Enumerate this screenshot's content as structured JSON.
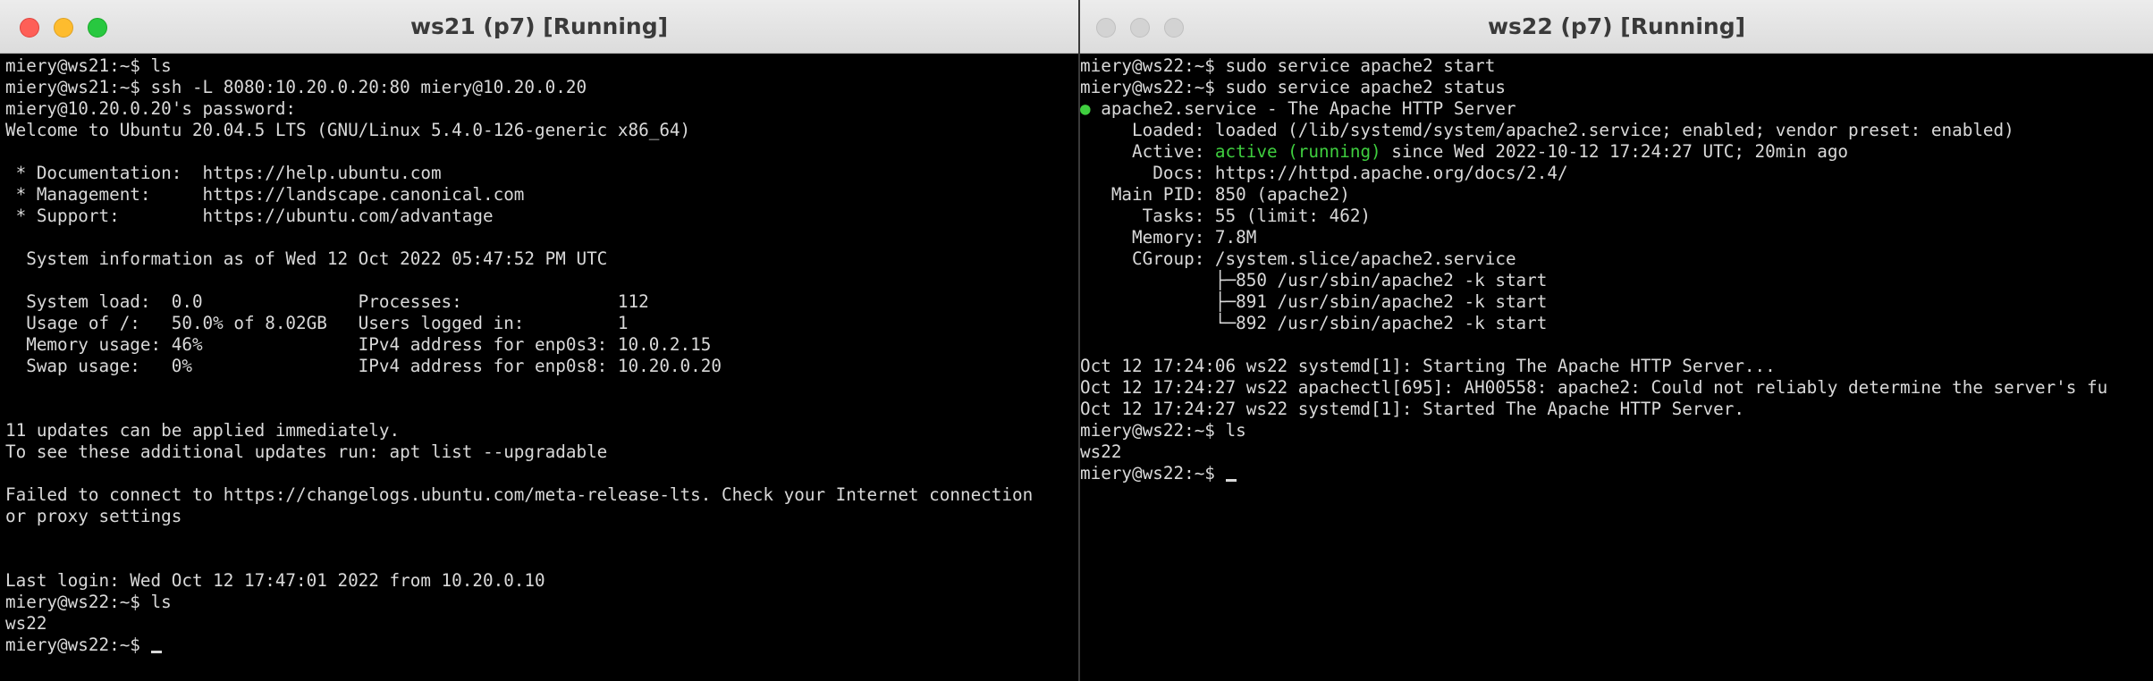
{
  "left_window": {
    "title": "ws21 (p7) [Running]",
    "lines": [
      "miery@ws21:~$ ls",
      "miery@ws21:~$ ssh -L 8080:10.20.0.20:80 miery@10.20.0.20",
      "miery@10.20.0.20's password:",
      "Welcome to Ubuntu 20.04.5 LTS (GNU/Linux 5.4.0-126-generic x86_64)",
      "",
      " * Documentation:  https://help.ubuntu.com",
      " * Management:     https://landscape.canonical.com",
      " * Support:        https://ubuntu.com/advantage",
      "",
      "  System information as of Wed 12 Oct 2022 05:47:52 PM UTC",
      "",
      "  System load:  0.0               Processes:               112",
      "  Usage of /:   50.0% of 8.02GB   Users logged in:         1",
      "  Memory usage: 46%               IPv4 address for enp0s3: 10.0.2.15",
      "  Swap usage:   0%                IPv4 address for enp0s8: 10.20.0.20",
      "",
      "",
      "11 updates can be applied immediately.",
      "To see these additional updates run: apt list --upgradable",
      "",
      "Failed to connect to https://changelogs.ubuntu.com/meta-release-lts. Check your Internet connection",
      "or proxy settings",
      "",
      "",
      "Last login: Wed Oct 12 17:47:01 2022 from 10.20.0.10",
      "miery@ws22:~$ ls",
      "ws22",
      "miery@ws22:~$ "
    ]
  },
  "right_window": {
    "title": "ws22 (p7) [Running]",
    "lines": [
      "miery@ws22:~$ sudo service apache2 start",
      "miery@ws22:~$ sudo service apache2 status",
      "● apache2.service - The Apache HTTP Server",
      "     Loaded: loaded (/lib/systemd/system/apache2.service; enabled; vendor preset: enabled)",
      "     Active: ",
      "       Docs: https://httpd.apache.org/docs/2.4/",
      "   Main PID: 850 (apache2)",
      "      Tasks: 55 (limit: 462)",
      "     Memory: 7.8M",
      "     CGroup: /system.slice/apache2.service",
      "             ├─850 /usr/sbin/apache2 -k start",
      "             ├─891 /usr/sbin/apache2 -k start",
      "             └─892 /usr/sbin/apache2 -k start",
      "",
      "Oct 12 17:24:06 ws22 systemd[1]: Starting The Apache HTTP Server...",
      "Oct 12 17:24:27 ws22 apachectl[695]: AH00558: apache2: Could not reliably determine the server's fu",
      "Oct 12 17:24:27 ws22 systemd[1]: Started The Apache HTTP Server.",
      "miery@ws22:~$ ls",
      "ws22",
      "miery@ws22:~$ "
    ],
    "active_status": "active (running)",
    "active_suffix": " since Wed 2022-10-12 17:24:27 UTC; 20min ago"
  },
  "colors": {
    "terminal_bg": "#000000",
    "terminal_fg": "#d9d9d9",
    "status_green": "#3fcf3f",
    "close_red": "#fe5f57",
    "minimize_yellow": "#febc2e",
    "maximize_green": "#28c840"
  },
  "icons": {
    "close": "close-button-icon",
    "minimize": "minimize-button-icon",
    "maximize": "zoom-button-icon"
  }
}
